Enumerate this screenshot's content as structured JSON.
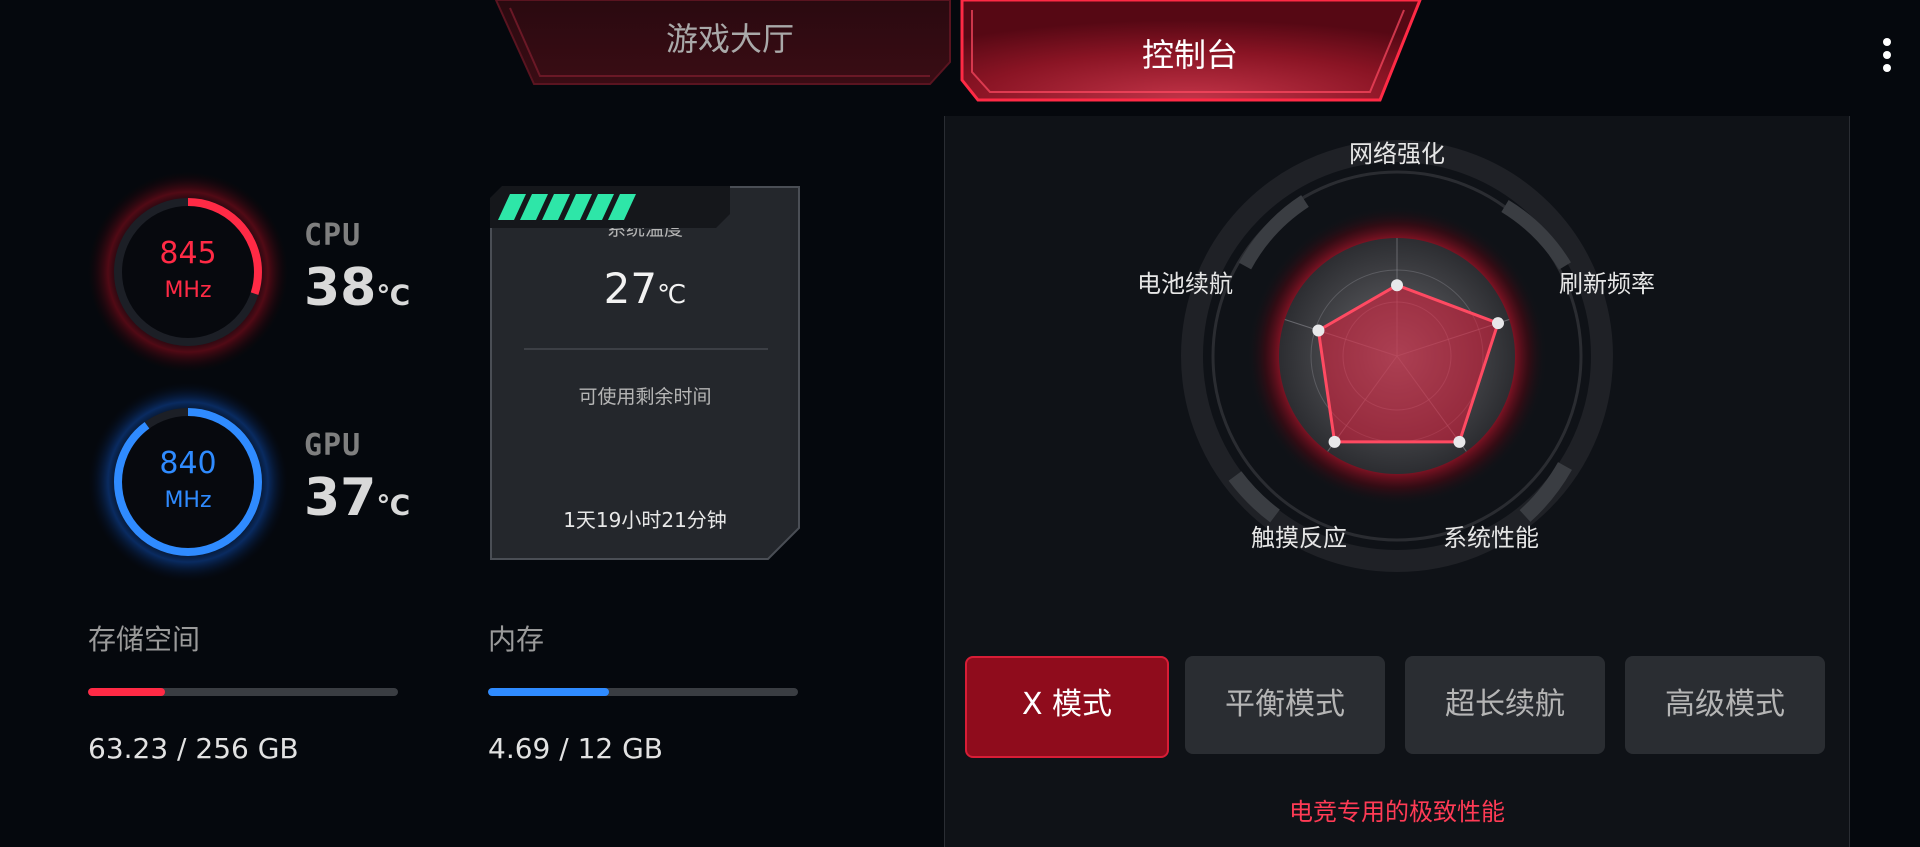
{
  "tabs": {
    "lobby": "游戏大厅",
    "console": "控制台",
    "active": "console"
  },
  "menu": {
    "icon": "more-vertical-icon"
  },
  "cpu": {
    "label": "CPU",
    "freq": "845",
    "unit": "MHz",
    "temp": "38",
    "temp_unit": "℃",
    "load": 0.3,
    "color": "#ff2a45"
  },
  "gpu": {
    "label": "GPU",
    "freq": "840",
    "unit": "MHz",
    "temp": "37",
    "temp_unit": "℃",
    "load": 0.9,
    "color": "#2f8bff"
  },
  "system": {
    "temp_title": "系统温度",
    "temp_value": "27",
    "temp_unit": "℃",
    "remaining_title": "可使用剩余时间",
    "remaining_value": "1天19小时21分钟",
    "battery_bars": 6,
    "battery_color": "#2ee6a8"
  },
  "storage": {
    "label": "存储空间",
    "value": "63.23 / 256 GB",
    "fraction": 0.247,
    "color": "#ff2a45"
  },
  "memory": {
    "label": "内存",
    "value": "4.69 / 12 GB",
    "fraction": 0.391,
    "color": "#2f8bff"
  },
  "radar": {
    "axes": [
      "网络强化",
      "刷新频率",
      "系统性能",
      "触摸反应",
      "电池续航"
    ],
    "values": [
      0.6,
      0.9,
      0.9,
      0.9,
      0.7
    ]
  },
  "modes": {
    "items": [
      "X 模式",
      "平衡模式",
      "超长续航",
      "高级模式"
    ],
    "selected": 0,
    "description": "电竞专用的极致性能"
  }
}
